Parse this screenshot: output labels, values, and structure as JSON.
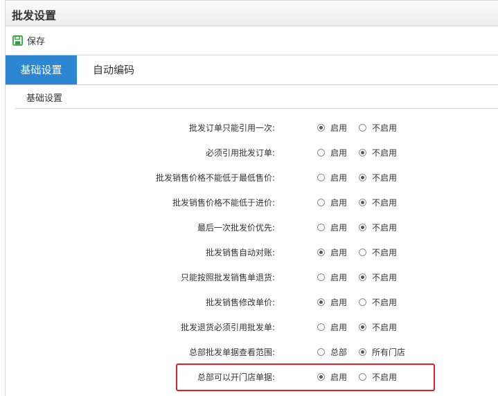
{
  "window": {
    "title": "批发设置"
  },
  "toolbar": {
    "save_label": "保存"
  },
  "tabs": [
    {
      "label": "基础设置",
      "active": true
    },
    {
      "label": "自动编码",
      "active": false
    }
  ],
  "section": {
    "title": "基础设置"
  },
  "settings": [
    {
      "label": "批发订单只能引用一次:",
      "options": [
        "启用",
        "不启用"
      ],
      "selected": "启用"
    },
    {
      "label": "必须引用批发订单:",
      "options": [
        "启用",
        "不启用"
      ],
      "selected": "不启用"
    },
    {
      "label": "批发销售价格不能低于最低售价:",
      "options": [
        "启用",
        "不启用"
      ],
      "selected": "不启用"
    },
    {
      "label": "批发销售价格不能低于进价:",
      "options": [
        "启用",
        "不启用"
      ],
      "selected": "不启用"
    },
    {
      "label": "最后一次批发价优先:",
      "options": [
        "启用",
        "不启用"
      ],
      "selected": "不启用"
    },
    {
      "label": "批发销售自动对账:",
      "options": [
        "启用",
        "不启用"
      ],
      "selected": "启用"
    },
    {
      "label": "只能按照批发销售单退货:",
      "options": [
        "启用",
        "不启用"
      ],
      "selected": "不启用"
    },
    {
      "label": "批发销售修改单价:",
      "options": [
        "启用",
        "不启用"
      ],
      "selected": "启用"
    },
    {
      "label": "批发退货必须引用批发单:",
      "options": [
        "启用",
        "不启用"
      ],
      "selected": "不启用"
    },
    {
      "label": "总部批发单据查看范围:",
      "options": [
        "总部",
        "所有门店"
      ],
      "selected": "所有门店"
    },
    {
      "label": "总部可以开门店单据:",
      "options": [
        "启用",
        "不启用"
      ],
      "selected": "启用"
    }
  ],
  "colors": {
    "tab_active_bg": "#2c86d2",
    "highlight_border": "#e02020",
    "save_icon": "#2e9e3e"
  }
}
